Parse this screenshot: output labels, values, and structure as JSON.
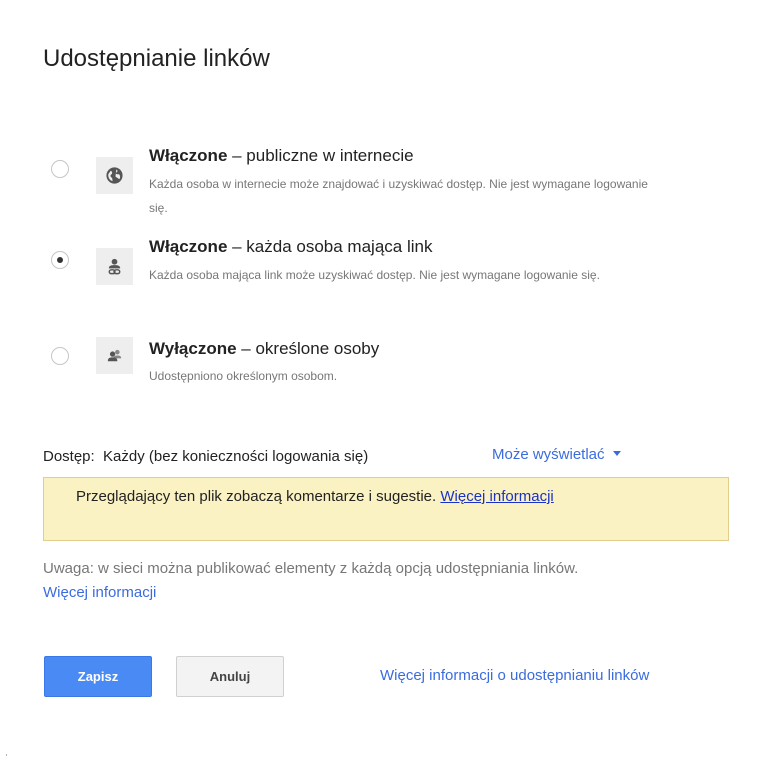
{
  "dialog": {
    "title": "Udostępnianie linków"
  },
  "options": [
    {
      "state": "Włączone",
      "suffix": " – publiczne w internecie",
      "description": "Każda osoba w internecie może znajdować i uzyskiwać dostęp. Nie jest wymagane logowanie się.",
      "icon": "globe-icon",
      "selected": false
    },
    {
      "state": "Włączone",
      "suffix": " – każda osoba mająca link",
      "description": "Każda osoba mająca link może uzyskiwać dostęp. Nie jest wymagane logowanie się.",
      "icon": "person-link-icon",
      "selected": true
    },
    {
      "state": "Wyłączone",
      "suffix": " – określone osoby",
      "description": "Udostępniono określonym osobom.",
      "icon": "people-icon",
      "selected": false
    }
  ],
  "access": {
    "label": "Dostęp:",
    "value": "Każdy (bez konieczności logowania się)",
    "permission": "Może wyświetlać"
  },
  "notice": {
    "text": "Przeglądający ten plik zobaczą komentarze i sugestie.",
    "link": "Więcej informacji"
  },
  "note": {
    "text": "Uwaga: w sieci można publikować elementy z każdą opcją udostępniania linków.",
    "link": "Więcej informacji"
  },
  "buttons": {
    "save": "Zapisz",
    "cancel": "Anuluj"
  },
  "footer": {
    "help_link": "Więcej informacji o udostępnianiu linków"
  },
  "colors": {
    "accent": "#4a8af4",
    "link": "#3b6cde",
    "notice_bg": "#fbf2c4"
  }
}
